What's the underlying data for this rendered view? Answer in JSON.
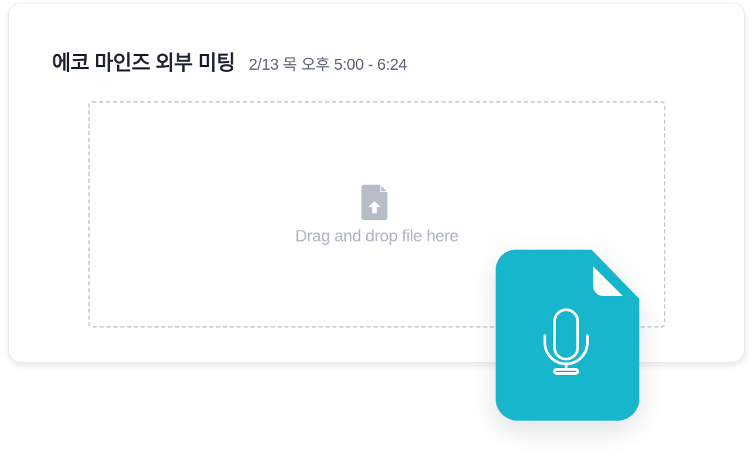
{
  "meeting": {
    "title": "에코 마인즈 외부 미팅",
    "time": "2/13 목 오후 5:00 - 6:24"
  },
  "dropzone": {
    "text": "Drag and drop file here",
    "icon": "file-upload-icon"
  },
  "audio_file": {
    "icon": "microphone-icon"
  },
  "colors": {
    "accent": "#17b6cd",
    "upload_icon": "#b7bdc8",
    "title": "#1f2533",
    "muted": "#aeb5c2",
    "dash_border": "#c9ccd6"
  }
}
